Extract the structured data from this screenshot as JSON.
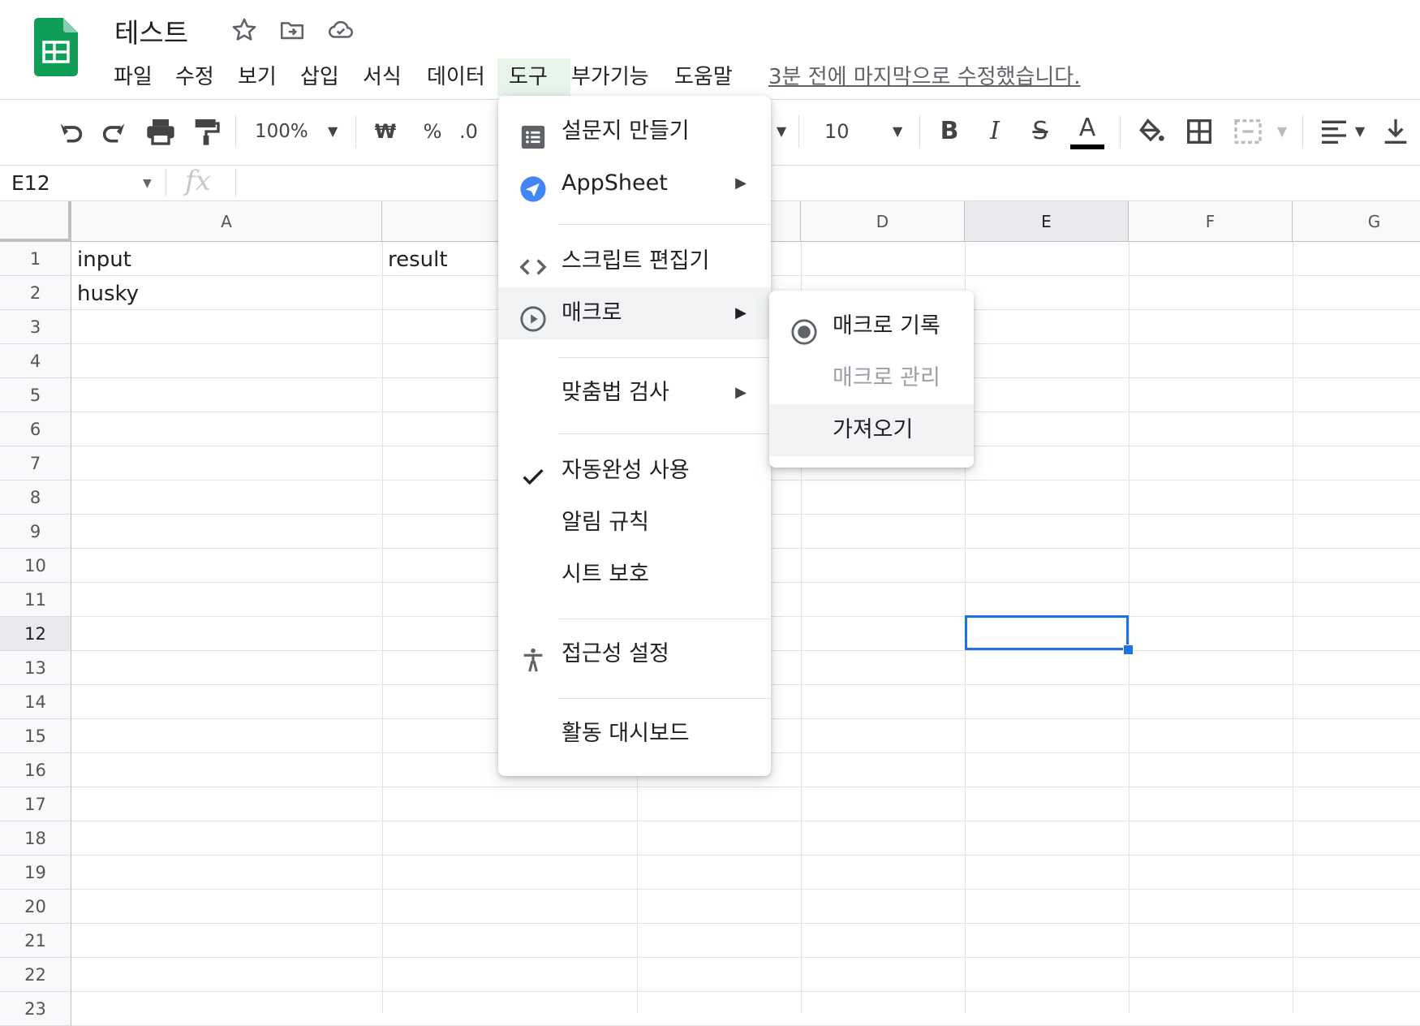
{
  "app": {
    "doc_title": "테스트",
    "last_edit": "3분 전에 마지막으로 수정했습니다.",
    "icons": [
      "star-icon",
      "move-folder-icon",
      "cloud-saved-icon"
    ],
    "brand_color": "#0f9d58"
  },
  "menubar": {
    "items": [
      "파일",
      "수정",
      "보기",
      "삽입",
      "서식",
      "데이터",
      "도구",
      "부가기능",
      "도움말"
    ],
    "active": "도구"
  },
  "toolbar": {
    "zoom": "100%",
    "currency": "₩",
    "percent": "%",
    "decimal": ".0",
    "font_size": "10",
    "bold": "B",
    "italic": "I",
    "strike": "S",
    "text_color": "A"
  },
  "formula_bar": {
    "name_box": "E12",
    "fx": "fx"
  },
  "grid": {
    "columns": [
      "A",
      "",
      "",
      "D",
      "E",
      "F",
      "G"
    ],
    "selected_column": "E",
    "rows": [
      "1",
      "2",
      "3",
      "4",
      "5",
      "6",
      "7",
      "8",
      "9",
      "10",
      "11",
      "12",
      "13",
      "14",
      "15",
      "16",
      "17",
      "18",
      "19",
      "20",
      "21",
      "22",
      "23"
    ],
    "selected_row": "12",
    "cells": {
      "A1": "input",
      "B1": "result",
      "A2": "husky"
    },
    "selected_cell": "E12",
    "selection_color": "#1a73e8"
  },
  "tools_menu": {
    "items": [
      {
        "label": "설문지 만들기",
        "icon": "form-icon"
      },
      {
        "label": "AppSheet",
        "icon": "appsheet-icon",
        "submenu": true
      },
      {
        "label": "스크립트 편집기",
        "icon": "code-icon"
      },
      {
        "label": "매크로",
        "icon": "macro-play-icon",
        "submenu": true,
        "highlighted": true
      },
      {
        "label": "맞춤법 검사",
        "submenu": true
      },
      {
        "label": "자동완성 사용",
        "icon": "check-icon",
        "checked": true
      },
      {
        "label": "알림 규칙"
      },
      {
        "label": "시트 보호"
      },
      {
        "label": "접근성 설정",
        "icon": "accessibility-icon"
      },
      {
        "label": "활동 대시보드"
      }
    ]
  },
  "macro_submenu": {
    "items": [
      {
        "label": "매크로 기록",
        "icon": "record-icon"
      },
      {
        "label": "매크로 관리",
        "disabled": true
      },
      {
        "label": "가져오기",
        "highlighted": true
      }
    ]
  }
}
